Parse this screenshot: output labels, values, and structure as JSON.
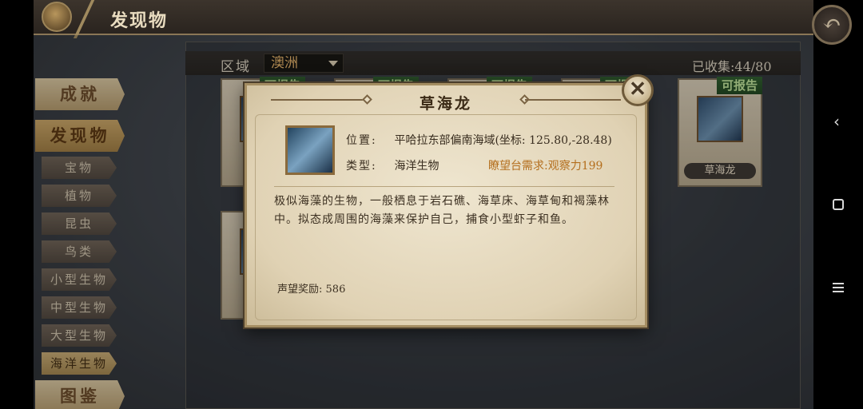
{
  "header": {
    "title": "发现物"
  },
  "filter": {
    "region_label": "区域",
    "region_value": "澳洲",
    "collected": "已收集:44/80"
  },
  "sidebar": {
    "main_items": [
      "成就",
      "发现物",
      "图鉴"
    ],
    "sub_items": [
      "宝物",
      "植物",
      "昆虫",
      "鸟类",
      "小型生物",
      "中型生物",
      "大型生物",
      "海洋生物"
    ],
    "active_sub": "海洋生物"
  },
  "cards": {
    "badge": "可报告",
    "visible_card_name": "草海龙"
  },
  "modal": {
    "title": "草海龙",
    "location_label": "位置:",
    "location_value": "平哈拉东部偏南海域(坐标: 125.80,-28.48)",
    "type_label": "类型:",
    "type_value": "海洋生物",
    "requirement": "瞭望台需求:观察力199",
    "description": "极似海藻的生物，一般栖息于岩石礁、海草床、海草甸和褐藻林中。拟态成周围的海藻来保护自己，捕食小型虾子和鱼。",
    "reward_label": "声望奖励:",
    "reward_value": "586",
    "close_symbol": "✕"
  },
  "android_nav": {
    "back": "‹"
  },
  "colors": {
    "accent_gold": "#c9a566",
    "requirement_orange": "#b46f1e",
    "badge_green": "#2f5e2e"
  }
}
